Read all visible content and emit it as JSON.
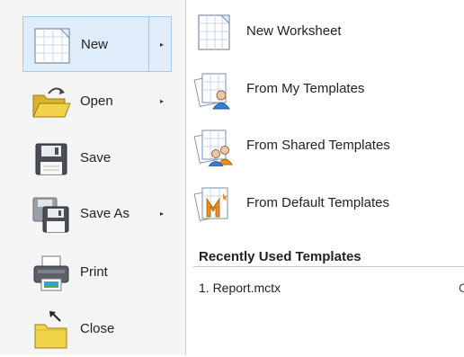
{
  "left_menu": {
    "items": [
      {
        "label": "New",
        "icon": "new-worksheet-icon",
        "has_submenu": true,
        "selected": true
      },
      {
        "label": "Open",
        "icon": "open-folder-icon",
        "has_submenu": true
      },
      {
        "label": "Save",
        "icon": "floppy-disk-icon",
        "has_submenu": false
      },
      {
        "label": "Save As",
        "icon": "save-as-icon",
        "has_submenu": true
      },
      {
        "label": "Print",
        "icon": "printer-icon",
        "has_submenu": false
      },
      {
        "label": "Close",
        "icon": "close-folder-icon",
        "has_submenu": false
      }
    ],
    "submenu_glyph": "▸"
  },
  "new_panel": {
    "options": [
      {
        "label": "New Worksheet",
        "icon": "worksheet-icon"
      },
      {
        "label": "From My Templates",
        "icon": "my-templates-icon"
      },
      {
        "label": "From Shared Templates",
        "icon": "shared-templates-icon"
      },
      {
        "label": "From Default Templates",
        "icon": "default-templates-icon"
      }
    ],
    "recent_title": "Recently Used Templates",
    "recent_items": [
      {
        "label": "1. Report.mctx"
      }
    ],
    "pin_glyph": "C"
  },
  "colors": {
    "selection_bg": "#dfecf9",
    "selection_border": "#a9c8e8",
    "left_bg": "#f5f5f5",
    "folder_yellow": "#f2d44a",
    "template_orange": "#e8911c"
  }
}
